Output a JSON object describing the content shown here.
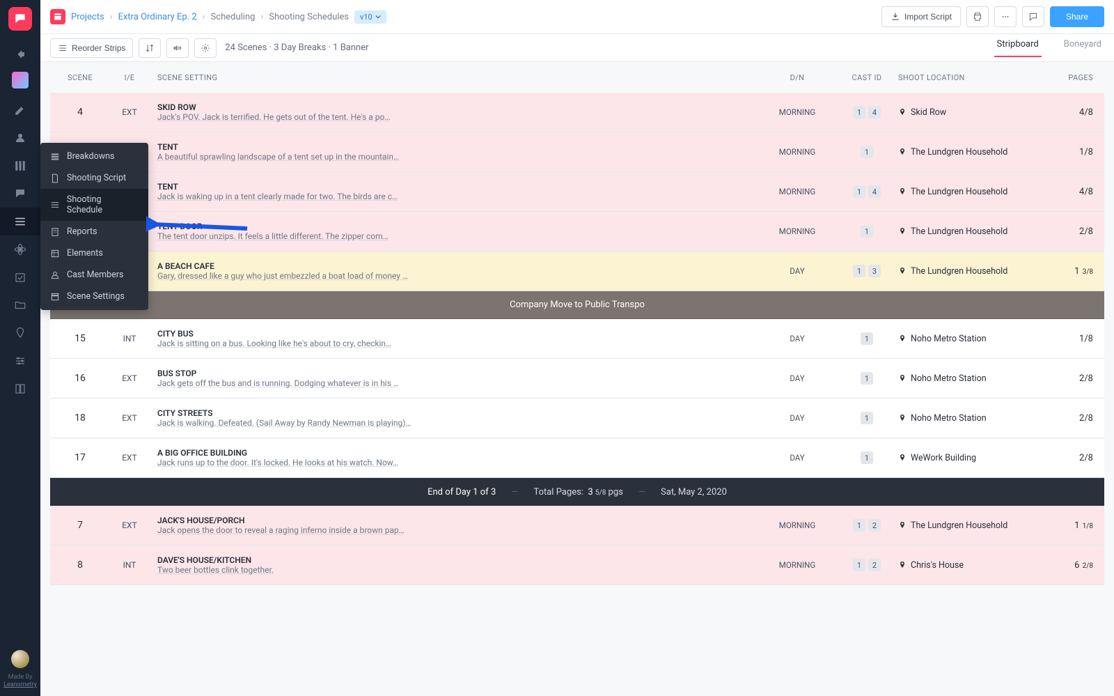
{
  "breadcrumbs": {
    "projects": "Projects",
    "project": "Extra Ordinary Ep. 2",
    "section": "Scheduling",
    "page": "Shooting Schedules",
    "version": "v10"
  },
  "top_actions": {
    "import": "Import Script",
    "share": "Share"
  },
  "toolbar": {
    "reorder": "Reorder Strips",
    "summary": "24 Scenes · 3 Day Breaks · 1 Banner"
  },
  "tabs": {
    "stripboard": "Stripboard",
    "boneyard": "Boneyard"
  },
  "columns": {
    "scene": "SCENE",
    "ie": "I/E",
    "setting": "SCENE SETTING",
    "dn": "D/N",
    "cast": "CAST ID",
    "loc": "SHOOT LOCATION",
    "pages": "PAGES"
  },
  "side_menu": [
    {
      "label": "Breakdowns"
    },
    {
      "label": "Shooting Script"
    },
    {
      "label": "Shooting Schedule",
      "active": true
    },
    {
      "label": "Reports"
    },
    {
      "label": "Elements"
    },
    {
      "label": "Cast Members"
    },
    {
      "label": "Scene Settings"
    }
  ],
  "rows": [
    {
      "type": "strip",
      "scene": "4",
      "ie": "EXT",
      "title": "SKID ROW",
      "desc": "Jack's POV. Jack is terrified. He gets out of the tent. He's a po…",
      "dn": "MORNING",
      "cast": [
        "1",
        "4"
      ],
      "loc": "Skid Row",
      "pages": "4/8",
      "bg": "bg-pink"
    },
    {
      "type": "strip",
      "scene": "",
      "ie": "",
      "title": "TENT",
      "desc": "A beautiful sprawling landscape of a tent set up in the mountain…",
      "dn": "MORNING",
      "cast": [
        "1"
      ],
      "loc": "The Lundgren Household",
      "pages": "1/8",
      "bg": "bg-pink"
    },
    {
      "type": "strip",
      "scene": "",
      "ie": "",
      "title": "TENT",
      "desc": "Jack is waking up in a tent clearly made for two. The birds are c…",
      "dn": "MORNING",
      "cast": [
        "1",
        "4"
      ],
      "loc": "The Lundgren Household",
      "pages": "4/8",
      "bg": "bg-pink"
    },
    {
      "type": "strip",
      "scene": "",
      "ie": "",
      "title": "TENT DOOR",
      "desc": "The tent door unzips. It feels a little different. The zipper com…",
      "dn": "MORNING",
      "cast": [
        "1"
      ],
      "loc": "The Lundgren Household",
      "pages": "2/8",
      "bg": "bg-pink"
    },
    {
      "type": "strip",
      "scene": "",
      "ie": "",
      "title": "A BEACH CAFE",
      "desc": "Gary, dressed like a guy who just embezzled a boat load of money …",
      "dn": "DAY",
      "cast": [
        "1",
        "3"
      ],
      "loc": "The Lundgren Household",
      "pages_whole": "1",
      "pages": "3/8",
      "bg": "bg-yellow"
    },
    {
      "type": "banner",
      "text": "Company Move to Public Transpo"
    },
    {
      "type": "strip",
      "scene": "15",
      "ie": "INT",
      "title": "CITY BUS",
      "desc": "Jack is sitting on a bus. Looking like he's about to cry, checkin…",
      "dn": "DAY",
      "cast": [
        "1"
      ],
      "loc": "Noho Metro Station",
      "pages": "1/8",
      "bg": "bg-white"
    },
    {
      "type": "strip",
      "scene": "16",
      "ie": "EXT",
      "title": "BUS STOP",
      "desc": "Jack gets off the bus and is running. Dodging whatever is in his …",
      "dn": "DAY",
      "cast": [
        "1"
      ],
      "loc": "Noho Metro Station",
      "pages": "2/8",
      "bg": "bg-white"
    },
    {
      "type": "strip",
      "scene": "18",
      "ie": "EXT",
      "title": "CITY STREETS",
      "desc": "Jack is walking. Defeated. (Sail Away by Randy Newman is playing)…",
      "dn": "DAY",
      "cast": [
        "1"
      ],
      "loc": "Noho Metro Station",
      "pages": "2/8",
      "bg": "bg-white"
    },
    {
      "type": "strip",
      "scene": "17",
      "ie": "EXT",
      "title": "A BIG OFFICE BUILDING",
      "desc": "Jack runs up to the door. It's locked. He looks at his watch. Now…",
      "dn": "DAY",
      "cast": [
        "1"
      ],
      "loc": "WeWork Building",
      "pages": "2/8",
      "bg": "bg-white"
    },
    {
      "type": "daybreak",
      "label": "End of Day 1 of 3",
      "total_label": "Total Pages:",
      "total_whole": "3",
      "total_frac": "5/8",
      "total_suffix": "pgs",
      "date": "Sat, May 2, 2020"
    },
    {
      "type": "strip",
      "scene": "7",
      "ie": "EXT",
      "title": "JACK'S HOUSE/PORCH",
      "desc": "Jack opens the door to reveal a raging inferno inside a brown pap…",
      "dn": "MORNING",
      "cast": [
        "1",
        "2"
      ],
      "loc": "The Lundgren Household",
      "pages_whole": "1",
      "pages": "1/8",
      "bg": "bg-pink"
    },
    {
      "type": "strip",
      "scene": "8",
      "ie": "INT",
      "title": "DAVE'S HOUSE/KITCHEN",
      "desc": "Two beer bottles clink together.",
      "dn": "MORNING",
      "cast": [
        "1",
        "2"
      ],
      "loc": "Chris's House",
      "pages_whole": "6",
      "pages": "2/8",
      "bg": "bg-pink"
    }
  ],
  "rail_footer": {
    "made": "Made By",
    "brand": "Leanometry"
  }
}
